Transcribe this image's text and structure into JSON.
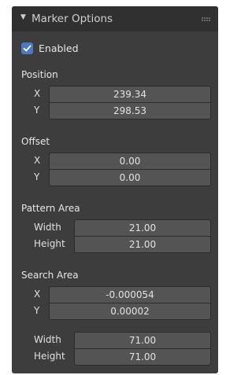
{
  "panel": {
    "title": "Marker Options",
    "collapse_icon": "triangle-down-icon",
    "drag_icon": "grip-dots-icon"
  },
  "enabled": {
    "label": "Enabled",
    "checked": true,
    "accent": "#4b79c4"
  },
  "position": {
    "label": "Position",
    "x_label": "X",
    "x_value": "239.34",
    "y_label": "Y",
    "y_value": "298.53"
  },
  "offset": {
    "label": "Offset",
    "x_label": "X",
    "x_value": "0.00",
    "y_label": "Y",
    "y_value": "0.00"
  },
  "pattern_area": {
    "label": "Pattern Area",
    "width_label": "Width",
    "width_value": "21.00",
    "height_label": "Height",
    "height_value": "21.00"
  },
  "search_area": {
    "label": "Search Area",
    "x_label": "X",
    "x_value": "-0.000054",
    "y_label": "Y",
    "y_value": "0.00002",
    "width_label": "Width",
    "width_value": "71.00",
    "height_label": "Height",
    "height_value": "71.00"
  }
}
